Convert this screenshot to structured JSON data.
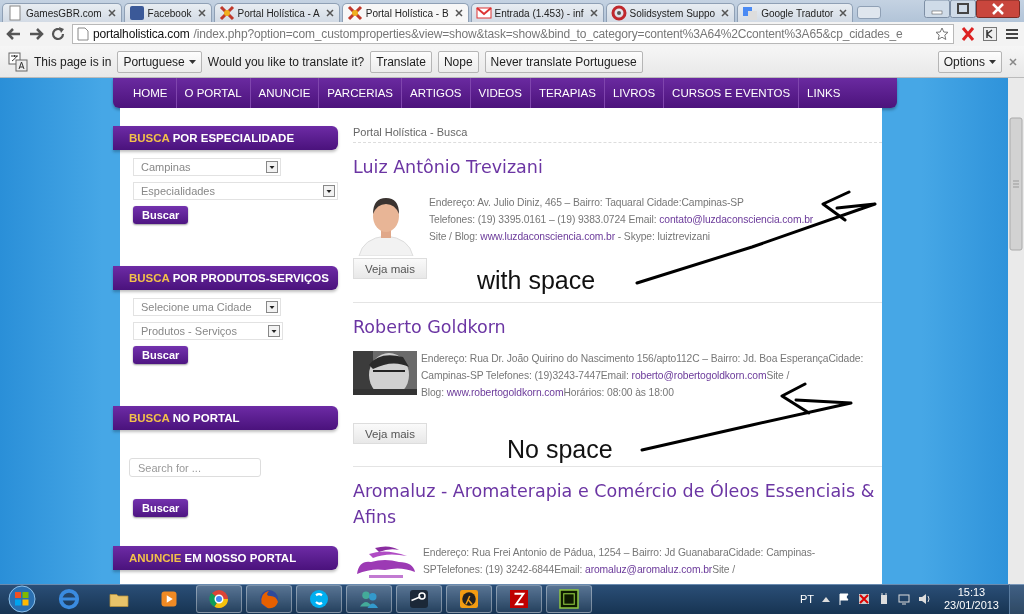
{
  "tabs": [
    {
      "title": "GamesGBR.com",
      "selected": false
    },
    {
      "title": "Facebook",
      "selected": false
    },
    {
      "title": "Portal Holística - A",
      "selected": false
    },
    {
      "title": "Portal Holística - B",
      "selected": true
    },
    {
      "title": "Entrada (1.453) - inf",
      "selected": false
    },
    {
      "title": "Solidsystem Suppo",
      "selected": false
    },
    {
      "title": "Google Tradutor",
      "selected": false
    }
  ],
  "address_bar": {
    "host": "portalholistica.com",
    "path": "/index.php?option=com_customproperties&view=show&task=show&bind_to_category=content%3A64%2Ccontent%3A65&cp_cidades_e"
  },
  "translate_bar": {
    "intro": "This page is in",
    "language": "Portuguese",
    "question": "Would you like to translate it?",
    "buttons": [
      "Translate",
      "Nope",
      "Never translate Portuguese"
    ],
    "options": "Options"
  },
  "nav": [
    "HOME",
    "O PORTAL",
    "ANUNCIE",
    "PARCERIAS",
    "ARTIGOS",
    "VIDEOS",
    "TERAPIAS",
    "LIVROS",
    "CURSOS E EVENTOS",
    "LINKS"
  ],
  "sidebar": [
    {
      "heading": "**BUSCA** POR ESPECIALIDADE",
      "controls": [
        {
          "kind": "select",
          "value": "Campinas"
        },
        {
          "kind": "select",
          "value": "Especialidades"
        },
        {
          "kind": "button",
          "label": "Buscar"
        }
      ]
    },
    {
      "heading": "**BUSCA** POR PRODUTOS-SERVIÇOS",
      "controls": [
        {
          "kind": "select",
          "value": "Selecione uma Cidade"
        },
        {
          "kind": "select",
          "value": "Produtos - Serviços"
        },
        {
          "kind": "button",
          "label": "Buscar"
        }
      ]
    },
    {
      "heading": "**BUSCA** NO PORTAL",
      "controls": [
        {
          "kind": "search",
          "placeholder": "Search for ..."
        },
        {
          "kind": "button",
          "label": "Buscar"
        }
      ]
    },
    {
      "heading": "**ANUNCIE** EM NOSSO PORTAL"
    }
  ],
  "breadcrumb": "Portal Holística - Busca",
  "results": [
    {
      "title": "Luiz Antônio Trevizani",
      "lines": [
        [
          {
            "kind": "text",
            "text": "Endereço: Av. Julio Diniz, 465 – Bairro: Taquaral Cidade:Campinas-SP"
          }
        ],
        [
          {
            "kind": "text",
            "text": "Telefones: (19) 3395.0161 – (19) 9383.0724 Email: "
          },
          {
            "kind": "link",
            "text": "contato@luzdaconsciencia.com.br"
          }
        ],
        [
          {
            "kind": "text",
            "text": "Site / Blog: "
          },
          {
            "kind": "link",
            "text": "www.luzdaconsciencia.com.br"
          },
          {
            "kind": "text",
            "text": " - Skype: luiztrevizani"
          }
        ]
      ],
      "button": "Veja mais"
    },
    {
      "title": "Roberto Goldkorn",
      "lines": [
        [
          {
            "kind": "text",
            "text": "Endereço: Rua Dr. João Quirino do Nascimento 156/apto112C – Bairro: Jd. Boa EsperançaCidade:"
          }
        ],
        [
          {
            "kind": "text",
            "text": " Campinas-SP Telefones: (19)3243-7447Email: "
          },
          {
            "kind": "link",
            "text": "roberto@robertogoldkorn.com"
          },
          {
            "kind": "text",
            "text": "Site /"
          }
        ],
        [
          {
            "kind": "text",
            "text": "Blog: "
          },
          {
            "kind": "link",
            "text": "www.robertogoldkorn.com"
          },
          {
            "kind": "text",
            "text": "Horários: 08:00 às 18:00"
          }
        ]
      ],
      "button": "Veja mais"
    },
    {
      "title": "Aromaluz - Aromaterapia e Comércio de Óleos Essenciais & Afins",
      "kind": "logo",
      "lines": [
        [
          {
            "kind": "text",
            "text": "Endereço: Rua Frei Antonio de Pádua, 1254 – Bairro: Jd GuanabaraCidade: Campinas-"
          }
        ],
        [
          {
            "kind": "text",
            "text": "SPTelefones: (19) 3242-6844Email: "
          },
          {
            "kind": "link",
            "text": "aromaluz@aromaluz.com.br"
          },
          {
            "kind": "text",
            "text": "Site /"
          }
        ]
      ]
    }
  ],
  "annotations": [
    "with space",
    "No space"
  ],
  "taskbar": {
    "apps": [
      {
        "running": false
      },
      {
        "running": false
      },
      {
        "running": false
      },
      {
        "running": true
      },
      {
        "running": true
      },
      {
        "running": true
      },
      {
        "running": true
      },
      {
        "running": true
      },
      {
        "running": true
      },
      {
        "running": true
      },
      {
        "running": true
      }
    ],
    "language": "PT",
    "time": "15:13",
    "date": "23/01/2013"
  }
}
